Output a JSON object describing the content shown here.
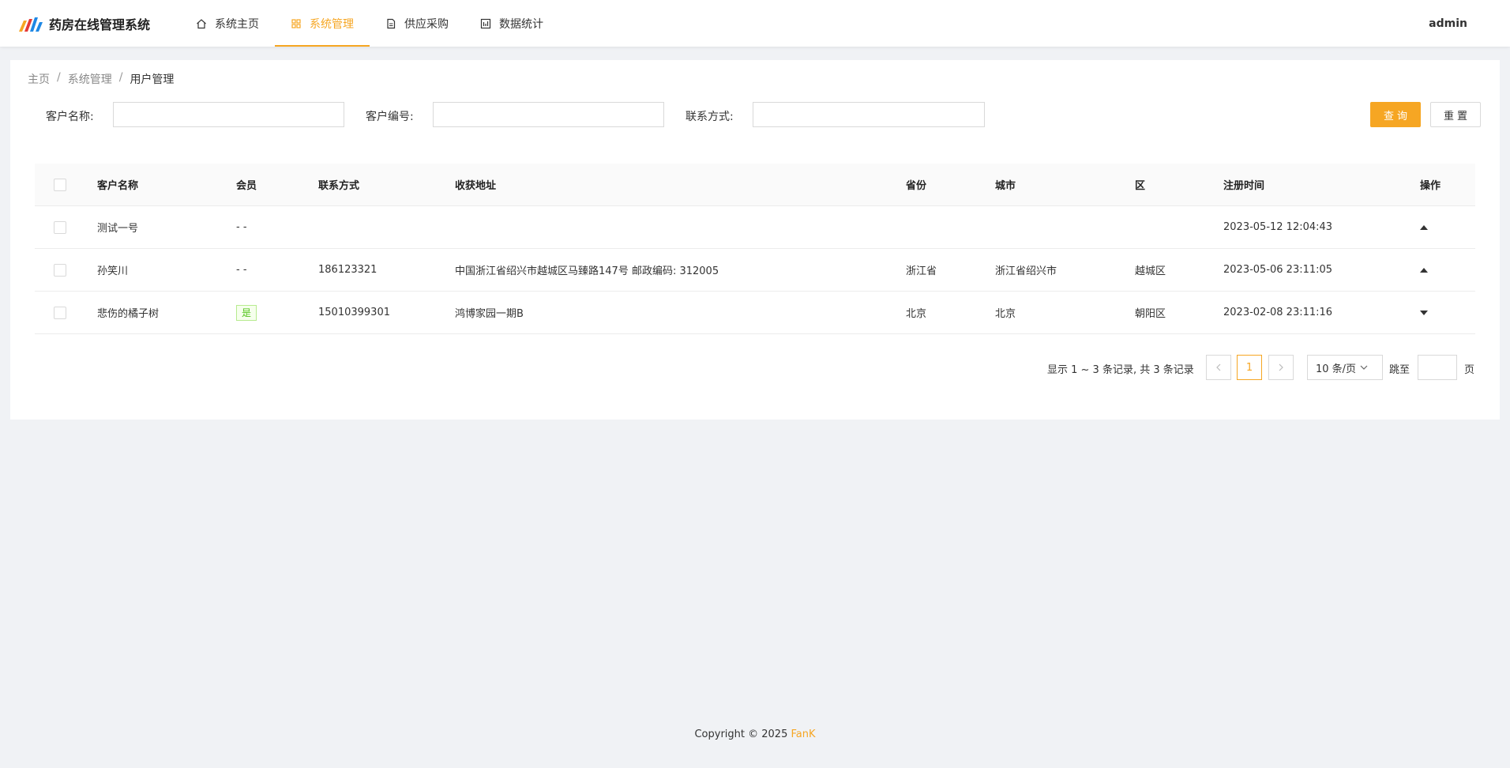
{
  "app": {
    "title": "药房在线管理系统",
    "user": "admin"
  },
  "nav": [
    {
      "label": "系统主页",
      "icon": "home-icon",
      "active": false
    },
    {
      "label": "系统管理",
      "icon": "grid-icon",
      "active": true
    },
    {
      "label": "供应采购",
      "icon": "document-icon",
      "active": false
    },
    {
      "label": "数据统计",
      "icon": "chart-icon",
      "active": false
    }
  ],
  "breadcrumb": {
    "home": "主页",
    "section": "系统管理",
    "current": "用户管理"
  },
  "search": {
    "name_label": "客户名称:",
    "name_value": "",
    "id_label": "客户编号:",
    "id_value": "",
    "contact_label": "联系方式:",
    "contact_value": "",
    "query_label": "查询",
    "reset_label": "重置"
  },
  "table": {
    "headers": {
      "name": "客户名称",
      "vip": "会员",
      "phone": "联系方式",
      "address": "收获地址",
      "province": "省份",
      "city": "城市",
      "district": "区",
      "time": "注册时间",
      "op": "操作"
    },
    "rows": [
      {
        "name": "测试一号",
        "vip": "- -",
        "phone": "",
        "address": "",
        "province": "",
        "city": "",
        "district": "",
        "time": "2023-05-12 12:04:43",
        "expanded": true
      },
      {
        "name": "孙笑川",
        "vip": "- -",
        "phone": "186123321",
        "address": "中国浙江省绍兴市越城区马臻路147号 邮政编码: 312005",
        "province": "浙江省",
        "city": "浙江省绍兴市",
        "district": "越城区",
        "time": "2023-05-06 23:11:05",
        "expanded": true
      },
      {
        "name": "悲伤的橘子树",
        "vip": "是",
        "phone": "15010399301",
        "address": "鸿博家园一期B",
        "province": "北京",
        "city": "北京",
        "district": "朝阳区",
        "time": "2023-02-08 23:11:16",
        "expanded": false
      }
    ]
  },
  "pagination": {
    "info": "显示 1 ~ 3 条记录, 共 3 条记录",
    "current_page": "1",
    "page_size": "10 条/页",
    "jump_label": "跳至",
    "page_suffix": "页"
  },
  "footer": {
    "text": "Copyright © 2025",
    "brand": "FanK"
  },
  "colors": {
    "accent": "#f6a623",
    "tag_green": "#52c41a"
  }
}
